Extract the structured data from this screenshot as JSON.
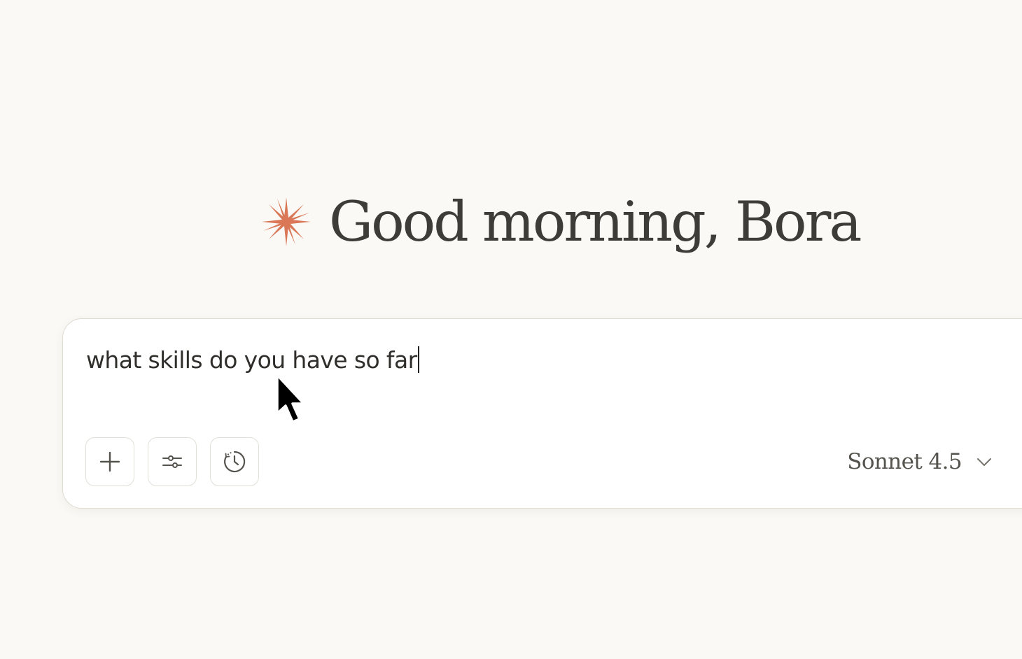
{
  "greeting": {
    "text": "Good morning, Bora",
    "accent_color": "#d97757",
    "icon": "spark-icon"
  },
  "composer": {
    "input_value": "what skills do you have so far",
    "toolbar": {
      "add_icon": "plus-icon",
      "settings_icon": "sliders-icon",
      "history_icon": "clock-icon"
    },
    "model": {
      "selected": "Sonnet 4.5",
      "icon": "chevron-down-icon"
    }
  },
  "pointer": {
    "icon": "mouse-pointer-icon"
  }
}
